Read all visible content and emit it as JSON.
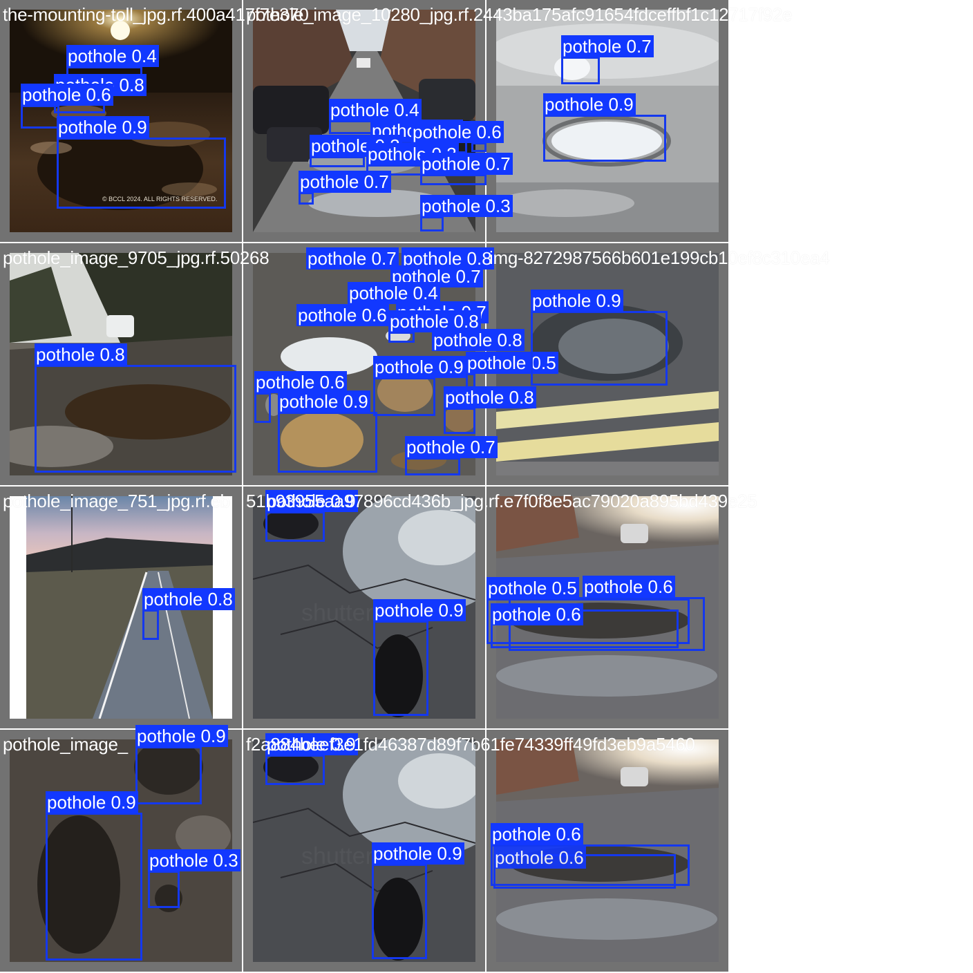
{
  "colors": {
    "box": "#1438ee",
    "label_bg": "#1238ff",
    "tile_bg": "#727272",
    "caption": "#ffffff"
  },
  "tiles": [
    {
      "caption": "the-mounting-toll_jpg.rf.400a417f7e370",
      "scene": "night",
      "detections": [
        {
          "label": "pothole 0.4"
        },
        {
          "label": "pothole 0.8"
        },
        {
          "label": "pothole 0.6"
        },
        {
          "label": "pothole 0.9"
        }
      ],
      "overlay_text": "© BCCL 2024. ALL RIGHTS RESERVED."
    },
    {
      "caption": "pothole_image_10280_jpg.rf.2443ba175afc91654fdceffbf1c12717f92e",
      "scene": "street",
      "detections": [
        {
          "label": "pothole 0.4"
        },
        {
          "label": "pothole 0.4"
        },
        {
          "label": "pothole 0.6"
        },
        {
          "label": "pothole 0.3"
        },
        {
          "label": "pothole 0.3"
        },
        {
          "label": "pothole 0.7"
        },
        {
          "label": "pothole 0.7"
        },
        {
          "label": "pothole 0.3"
        }
      ]
    },
    {
      "caption": "",
      "scene": "closeup-light",
      "detections": [
        {
          "label": "pothole 0.7"
        },
        {
          "label": "pothole 0.9"
        }
      ]
    },
    {
      "caption": "pothole_image_9705_jpg.rf.50268",
      "scene": "countryside",
      "detections": [
        {
          "label": "pothole 0.8"
        }
      ]
    },
    {
      "caption": "",
      "scene": "puddles",
      "detections": [
        {
          "label": "pothole 0.7"
        },
        {
          "label": "pothole 0.8"
        },
        {
          "label": "pothole 0.7"
        },
        {
          "label": "pothole 0.4"
        },
        {
          "label": "pothole 0.6"
        },
        {
          "label": "pothole 0.7"
        },
        {
          "label": "pothole 0.8"
        },
        {
          "label": "pothole 0.8"
        },
        {
          "label": "pothole 0.5"
        },
        {
          "label": "pothole 0.9"
        },
        {
          "label": "pothole 0.6"
        },
        {
          "label": "pothole 0.9"
        },
        {
          "label": "pothole 0.8"
        },
        {
          "label": "pothole 0.7"
        }
      ]
    },
    {
      "caption": "img-8272987566b601e199cb10ef8c310ea4",
      "scene": "yellow-lines",
      "detections": [
        {
          "label": "pothole 0.9"
        }
      ]
    },
    {
      "caption": "pothole_image_751_jpg.rf.eb",
      "scene": "rural-road",
      "detections": [
        {
          "label": "pothole 0.8"
        }
      ]
    },
    {
      "caption": "51b93955aa97896cd436b_jpg.rf.e7f0f8e5ac79020a895bd439e25",
      "scene": "cracked",
      "detections": [
        {
          "label": "pothole 0.9"
        },
        {
          "label": "pothole 0.9"
        }
      ]
    },
    {
      "caption": "",
      "scene": "sunny-street",
      "detections": [
        {
          "label": "pothole 0.5"
        },
        {
          "label": "pothole 0.6"
        },
        {
          "label": "pothole 0.6"
        }
      ]
    },
    {
      "caption": "pothole_image_",
      "scene": "dark-asphalt",
      "detections": [
        {
          "label": "pothole 0.9"
        },
        {
          "label": "pothole 0.9"
        },
        {
          "label": "pothole 0.3"
        }
      ]
    },
    {
      "caption": "f2a884beef3e1fd46387d89f7b61fe74339ff49fd3eb9a5460",
      "scene": "cracked",
      "detections": [
        {
          "label": "pothole 0.9"
        },
        {
          "label": "pothole 0.9"
        }
      ]
    },
    {
      "caption": "",
      "scene": "sunny-street",
      "detections": [
        {
          "label": "pothole 0.6"
        },
        {
          "label": "pothole 0.6"
        }
      ]
    }
  ]
}
